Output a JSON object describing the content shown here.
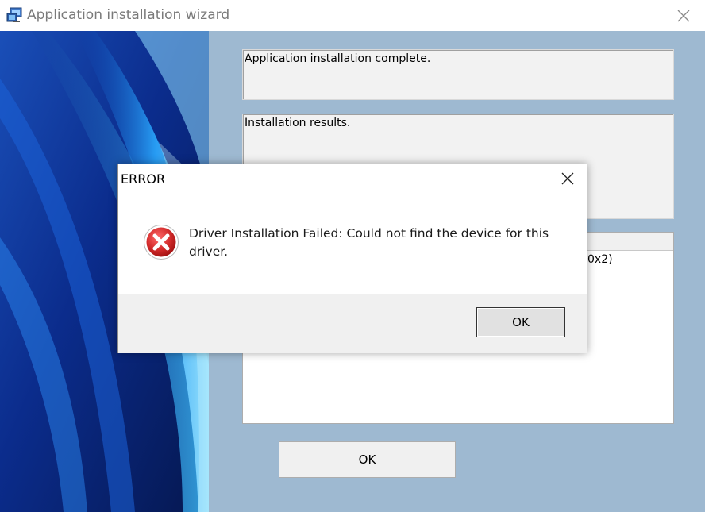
{
  "window": {
    "title": "Application installation wizard",
    "fields": {
      "status": "Application installation complete.",
      "results": "Installation results.",
      "results_partial_text": "0x2)"
    },
    "ok_label": "OK"
  },
  "dialog": {
    "title": "ERROR",
    "message": "Driver Installation Failed: Could not find the  device for this driver.",
    "ok_label": "OK"
  },
  "icons": {
    "app": "installer-icon",
    "close": "close-icon",
    "error": "error-icon"
  },
  "colors": {
    "window_bg": "#9eb9d1",
    "error_red": "#d22a2a",
    "banner_blue": "#0a2a7a"
  }
}
